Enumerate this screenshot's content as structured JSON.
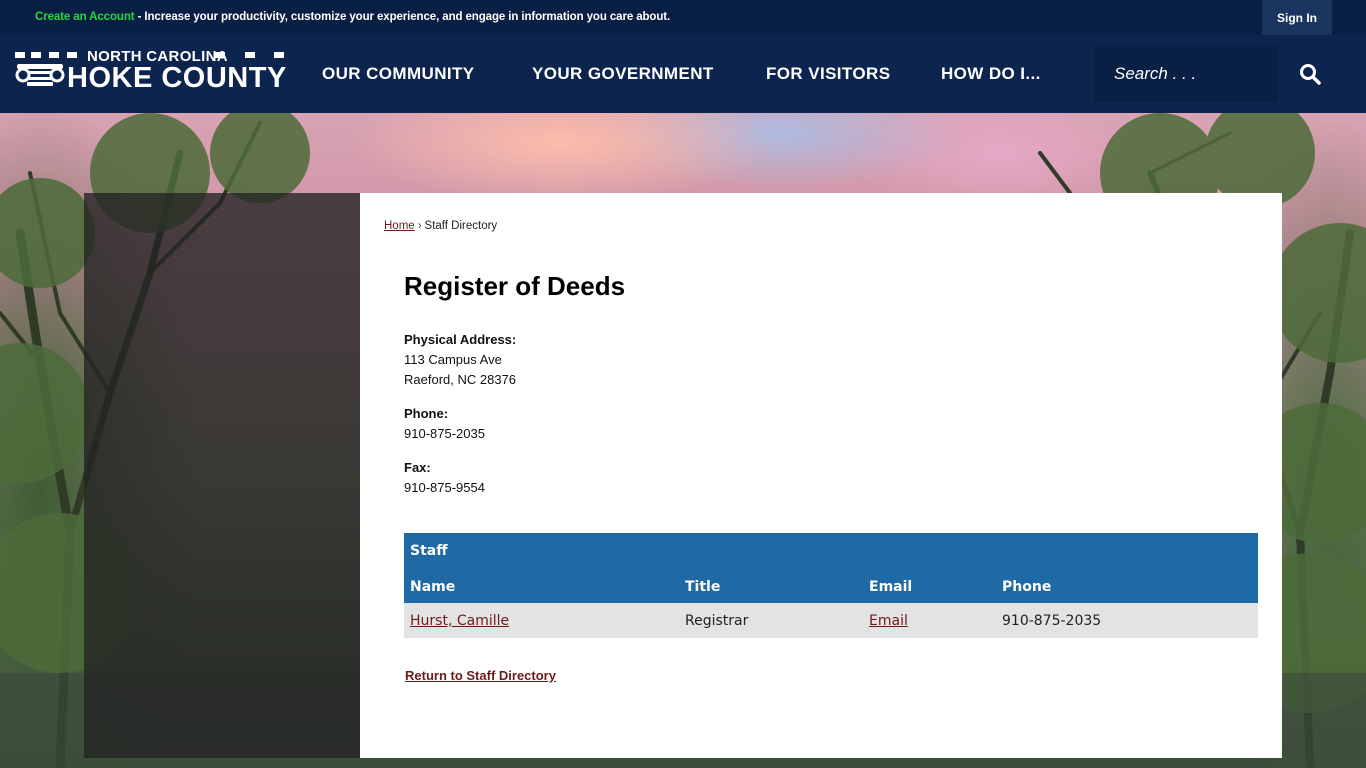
{
  "topbar": {
    "create_account": "Create an Account",
    "message": " - Increase your productivity, customize your experience, and engage in information you care about.",
    "sign_in": "Sign In"
  },
  "header": {
    "logo_top": "NORTH CAROLINA",
    "logo_main": "HOKE COUNTY",
    "nav": [
      "OUR COMMUNITY",
      "YOUR GOVERNMENT",
      "FOR VISITORS",
      "HOW DO I..."
    ],
    "search_placeholder": "Search . . ."
  },
  "breadcrumb": {
    "home": "Home",
    "separator": "›",
    "current": "Staff Directory"
  },
  "page": {
    "title": "Register of Deeds",
    "address_label": "Physical Address:",
    "address_line1": "113 Campus Ave",
    "address_line2": "Raeford, NC 28376",
    "phone_label": "Phone:",
    "phone": "910-875-2035",
    "fax_label": "Fax:",
    "fax": "910-875-9554"
  },
  "staff_table": {
    "caption": "Staff",
    "columns": [
      "Name",
      "Title",
      "Email",
      "Phone"
    ],
    "rows": [
      {
        "name": "Hurst, Camille",
        "title": "Registrar",
        "email": "Email",
        "phone": "910-875-2035"
      }
    ]
  },
  "return_link": "Return to Staff Directory",
  "colors": {
    "header_bg": "#0d244f",
    "topbar_bg": "#0a1f44",
    "table_header": "#1f6aa5",
    "link": "#6b1b1b",
    "create_account": "#27d63f"
  }
}
